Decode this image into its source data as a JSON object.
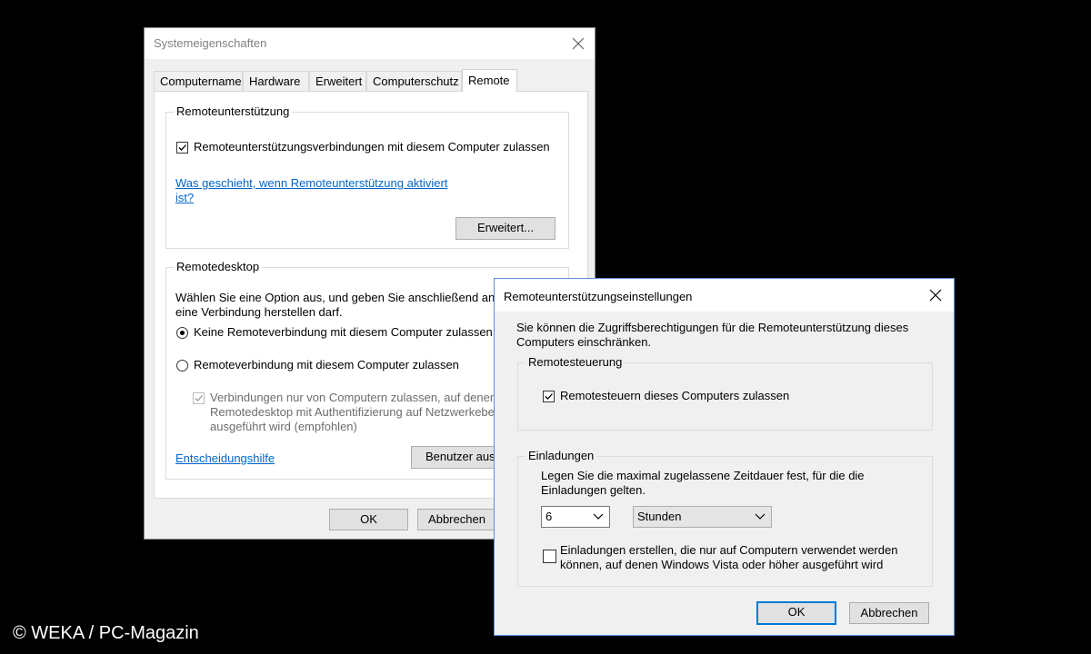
{
  "win1": {
    "title": "Systemeigenschaften",
    "tabs": [
      "Computername",
      "Hardware",
      "Erweitert",
      "Computerschutz",
      "Remote"
    ],
    "remote_assist": {
      "group_label": "Remoteunterstützung",
      "checkbox_label": "Remoteunterstützungsverbindungen mit diesem Computer zulassen",
      "checkbox_checked": true,
      "link_line1": "Was geschieht, wenn Remoteunterstützung aktiviert",
      "link_line2": "ist?",
      "advanced_button": "Erweitert..."
    },
    "remote_desktop": {
      "group_label": "Remotedesktop",
      "desc_line1": "Wählen Sie eine Option aus, und geben Sie anschließend an,",
      "desc_line2": "eine Verbindung herstellen darf.",
      "radio1_label": "Keine Remoteverbindung mit diesem Computer zulassen",
      "radio2_label": "Remoteverbindung mit diesem Computer zulassen",
      "nla_line1": "Verbindungen nur von Computern zulassen, auf denen",
      "nla_line2": "Remotedesktop mit Authentifizierung auf Netzwerkeben",
      "nla_line3": "ausgeführt wird (empfohlen)",
      "help_link": "Entscheidungshilfe",
      "users_button": "Benutzer aus"
    },
    "ok_button": "OK",
    "cancel_button": "Abbrechen"
  },
  "win2": {
    "title": "Remoteunterstützungseinstellungen",
    "intro_line1": "Sie können die Zugriffsberechtigungen für die Remoteunterstützung dieses",
    "intro_line2": "Computers einschränken.",
    "control": {
      "group_label": "Remotesteuerung",
      "checkbox_label": "Remotesteuern dieses Computers zulassen",
      "checkbox_checked": true
    },
    "invitations": {
      "group_label": "Einladungen",
      "desc_line1": "Legen Sie die maximal zugelassene Zeitdauer fest, für die die",
      "desc_line2": "Einladungen gelten.",
      "amount_value": "6",
      "unit_value": "Stunden",
      "vista_line1": "Einladungen erstellen, die nur auf Computern verwendet werden",
      "vista_line2": "können, auf denen Windows Vista oder höher ausgeführt wird",
      "vista_checked": false
    },
    "ok_button": "OK",
    "cancel_button": "Abbrechen"
  },
  "credit": "© WEKA / PC-Magazin",
  "icons": [
    "close-icon",
    "checkmark-icon",
    "chevron-down-icon"
  ],
  "colors": {
    "link": "#0066cc",
    "accent": "#0078d7",
    "background": "#000000"
  }
}
